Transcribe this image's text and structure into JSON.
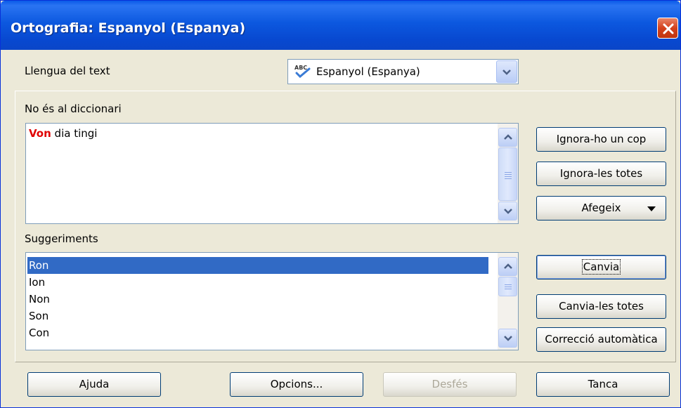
{
  "window": {
    "title": "Ortografia: Espanyol (Espanya)"
  },
  "language": {
    "label": "Llengua del text",
    "selected": "Espanyol (Espanya)"
  },
  "not_in_dictionary": {
    "label": "No és al diccionari",
    "error_word": "Von",
    "rest_text": " dia tingi"
  },
  "suggestions": {
    "label": "Suggeriments",
    "items": [
      "Ron",
      "Ion",
      "Non",
      "Son",
      "Con"
    ],
    "selected_index": 0
  },
  "buttons": {
    "ignore_once": "Ignora-ho un cop",
    "ignore_all": "Ignora-les totes",
    "add": "Afegeix",
    "change": "Canvia",
    "change_all": "Canvia-les totes",
    "autocorrect": "Correcció automàtica",
    "help": "Ajuda",
    "options": "Opcions...",
    "undo": "Desfés",
    "close": "Tanca"
  },
  "colors": {
    "title_bar": "#0c58df",
    "error_word": "#e00000",
    "selection": "#316ac5"
  }
}
